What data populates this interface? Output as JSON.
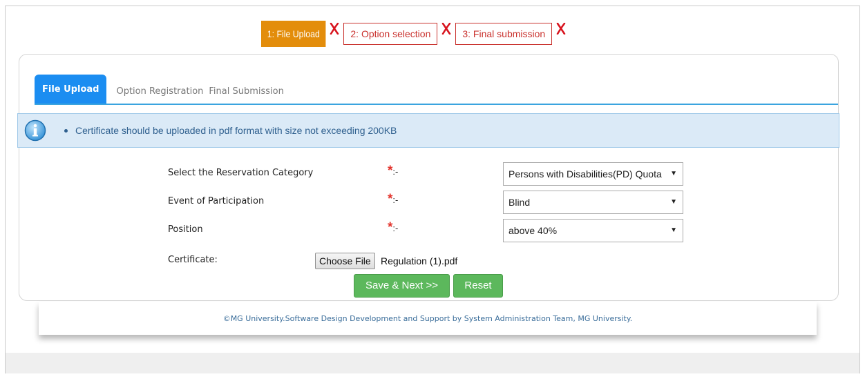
{
  "steps": [
    {
      "label": "1: File Upload",
      "state": "active"
    },
    {
      "label": "2: Option selection",
      "state": "pending"
    },
    {
      "label": "3: Final submission",
      "state": "pending"
    }
  ],
  "tabs": [
    "File Upload",
    "Option Registration",
    "Final Submission"
  ],
  "info": {
    "text": "Certificate should be uploaded in pdf format with size not exceeding 200KB"
  },
  "form": {
    "required_suffix": ":-",
    "reservation_label": "Select the Reservation Category",
    "reservation_value": "Persons with Disabilities(PD) Quota",
    "event_label": "Event of Participation",
    "event_value": "Blind",
    "position_label": "Position",
    "position_value": "above 40%",
    "certificate_label": "Certificate:",
    "choose_file_label": "Choose File",
    "file_name": "Regulation (1).pdf"
  },
  "buttons": {
    "save_next": "Save & Next >>",
    "reset": "Reset"
  },
  "footer": {
    "text": "©MG University.Software Design Development and Support by System Administration Team, MG University."
  },
  "colors": {
    "active_step": "#e38d0b",
    "pending_step": "#c9302c",
    "tab_active": "#1b8df1",
    "button": "#5cb85c",
    "info_bg": "#dbeaf7"
  },
  "icons": {
    "step_status": "cross-icon",
    "info": "info-icon",
    "select": "dropdown-arrow-icon"
  }
}
